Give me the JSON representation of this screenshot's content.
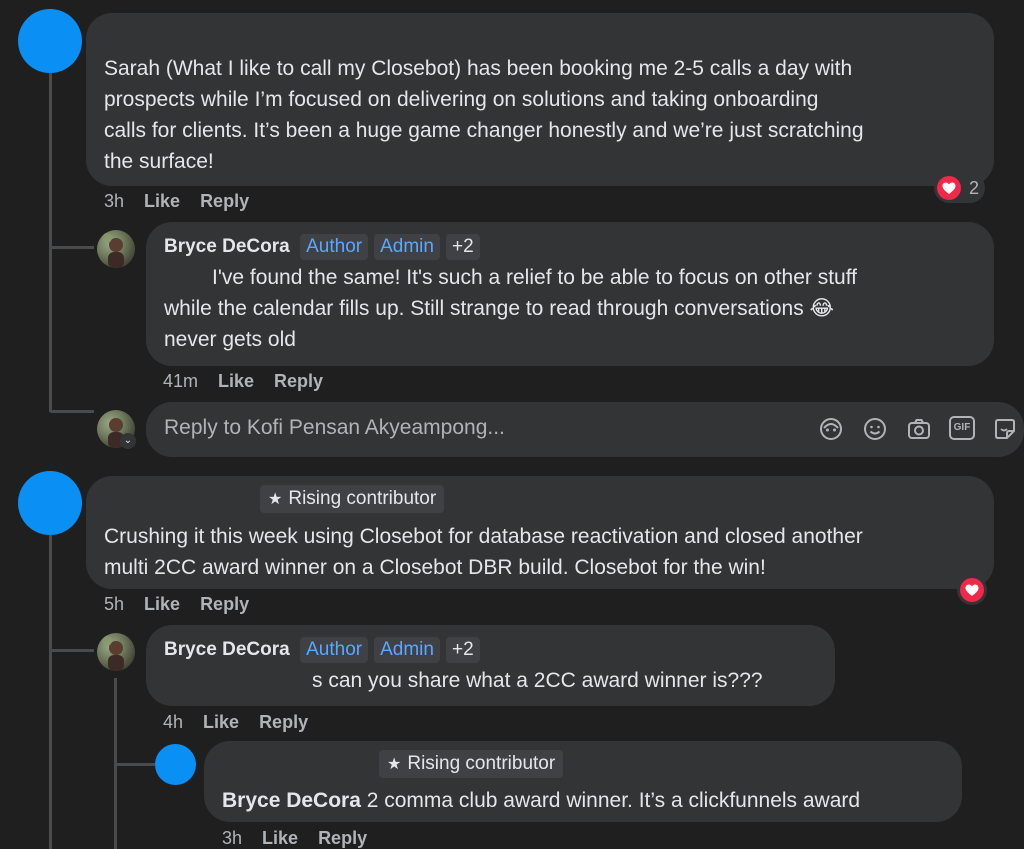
{
  "comments": [
    {
      "text_lines": [
        "Sarah (What I like to call my Closebot) has been booking me 2-5 calls a day with",
        "prospects while I’m focused on delivering on solutions and taking onboarding",
        "calls for clients. It’s been a huge game changer honestly and we’re just scratching",
        "the surface!"
      ],
      "time": "3h",
      "like": "Like",
      "reply": "Reply",
      "reaction_count": "2"
    },
    {
      "author": "Bryce DeCora",
      "badges": [
        "Author",
        "Admin",
        "+2"
      ],
      "text_lines": [
        "I've found the same! It's such a relief to be able to focus on other stuff",
        "while the calendar fills up. Still strange to read through conversations",
        "never gets old"
      ],
      "emoji": "😂",
      "time": "41m",
      "like": "Like",
      "reply": "Reply"
    },
    {
      "contributor_badge": "Rising contributor",
      "text_lines": [
        "Crushing it this week using Closebot for database reactivation and closed another",
        "multi 2CC award winner on a Closebot DBR build. Closebot for the win!"
      ],
      "time": "5h",
      "like": "Like",
      "reply": "Reply"
    },
    {
      "author": "Bryce DeCora",
      "badges": [
        "Author",
        "Admin",
        "+2"
      ],
      "text": "s can you share what a 2CC award winner is???",
      "time": "4h",
      "like": "Like",
      "reply": "Reply"
    },
    {
      "contributor_badge": "Rising contributor",
      "mention": "Bryce DeCora",
      "text": " 2 comma club award winner. It’s a clickfunnels award",
      "time": "3h",
      "like": "Like",
      "reply": "Reply"
    }
  ],
  "reply_box": {
    "placeholder": "Reply to Kofi Pensan Akyeampong...",
    "tools": [
      "avatar-sticker-icon",
      "emoji-icon",
      "camera-icon",
      "gif-icon",
      "sticker-icon"
    ],
    "gif_label": "GIF"
  },
  "colors": {
    "background": "#1f1f20",
    "bubble": "#333436",
    "accent_blue": "#0a8ff5",
    "badge_text": "#5aa7ff",
    "heart": "#f0284a"
  }
}
